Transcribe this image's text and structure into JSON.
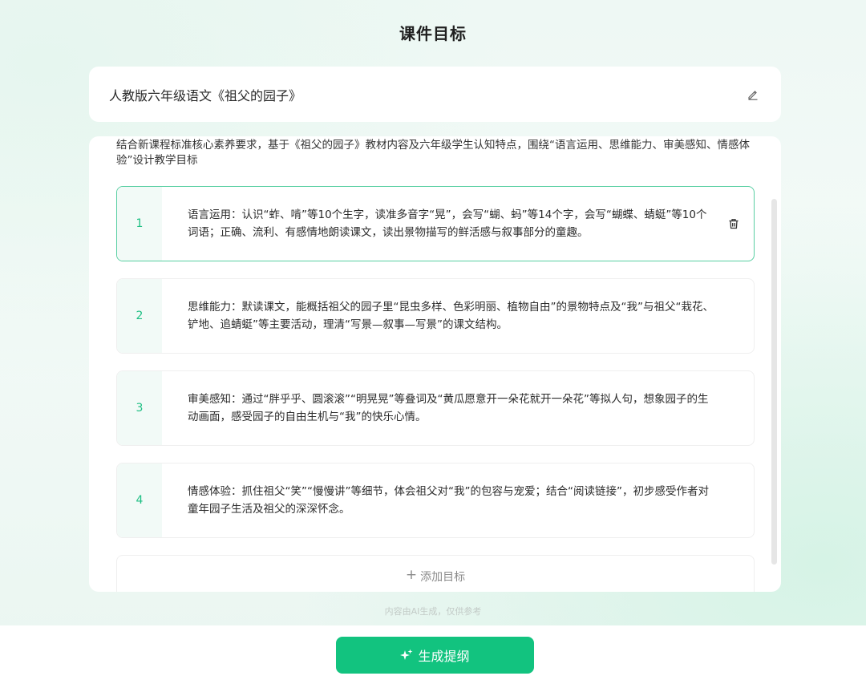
{
  "header": {
    "title": "课件目标"
  },
  "lesson": {
    "name": "人教版六年级语文《祖父的园子》",
    "edit_icon": "edit-pencil-icon"
  },
  "intro": "结合新课程标准核心素养要求，基于《祖父的园子》教材内容及六年级学生认知特点，围绕“语言运用、思维能力、审美感知、情感体验”设计教学目标",
  "goals": [
    {
      "number": "1",
      "text": "语言运用：认识“蚱、啃”等10个生字，读准多音字“晃”，会写“蝴、蚂”等14个字，会写“蝴蝶、蜻蜓”等10个词语；正确、流利、有感情地朗读课文，读出景物描写的鲜活感与叙事部分的童趣。"
    },
    {
      "number": "2",
      "text": "思维能力：默读课文，能概括祖父的园子里“昆虫多样、色彩明丽、植物自由”的景物特点及“我”与祖父“栽花、铲地、追蜻蜓”等主要活动，理清“写景—叙事—写景”的课文结构。"
    },
    {
      "number": "3",
      "text": "审美感知：通过“胖乎乎、圆滚滚”“明晃晃”等叠词及“黄瓜愿意开一朵花就开一朵花”等拟人句，想象园子的生动画面，感受园子的自由生机与“我”的快乐心情。"
    },
    {
      "number": "4",
      "text": "情感体验：抓住祖父“笑”“慢慢讲”等细节，体会祖父对“我”的包容与宠爱；结合“阅读链接”，初步感受作者对童年园子生活及祖父的深深怀念。"
    }
  ],
  "add_goal": {
    "plus": "+",
    "label": "添加目标"
  },
  "disclaimer": "内容由AI生成，仅供参考",
  "footer": {
    "generate_label": "生成提纲",
    "icon": "sparkle-icon"
  },
  "colors": {
    "accent": "#12c37f",
    "number": "#1fbf84",
    "active_border": "#58cfa2"
  }
}
